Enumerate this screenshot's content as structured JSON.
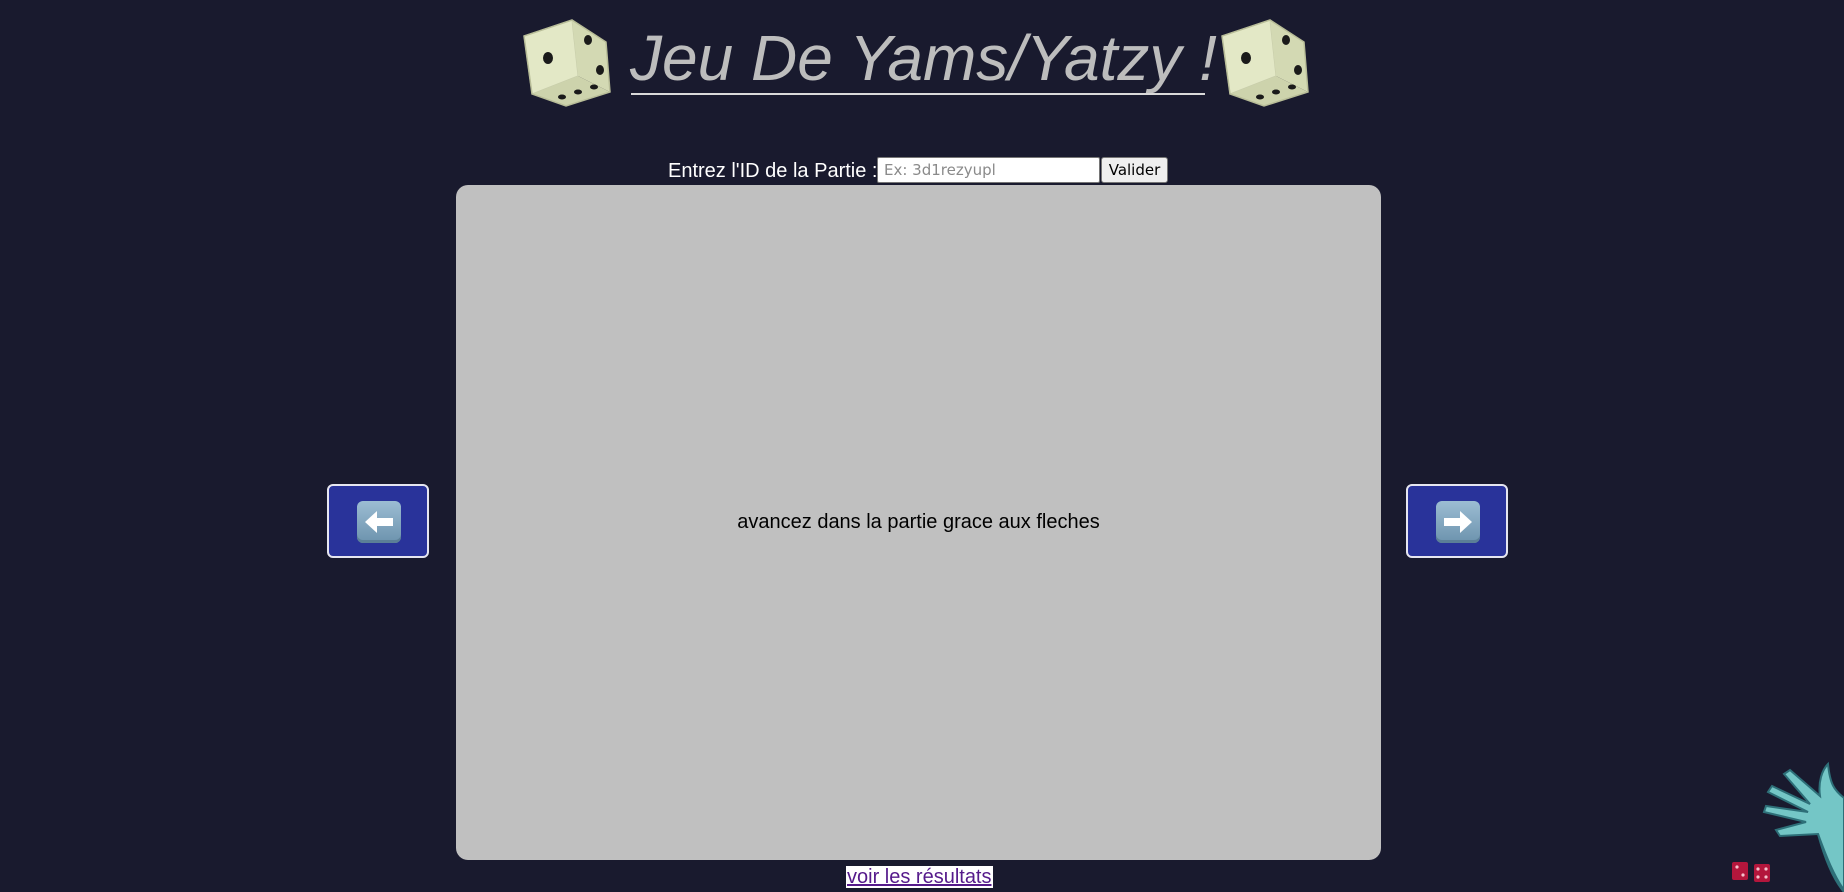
{
  "header": {
    "title": "Jeu De Yams/Yatzy !",
    "left_dice_icon": "dice-icon",
    "right_dice_icon": "dice-icon"
  },
  "game_id": {
    "label": "Entrez l'ID de la Partie :",
    "placeholder": "Ex: 3d1rezyupl",
    "value": "",
    "submit_label": "Valider"
  },
  "board": {
    "message": "avancez dans la partie grace aux fleches"
  },
  "navigation": {
    "prev_icon": "left-arrow-icon",
    "next_icon": "right-arrow-icon"
  },
  "footer": {
    "results_link": "voir les résultats",
    "decoration_icon": "hand-dice-icon"
  },
  "colors": {
    "background": "#191a2e",
    "board": "#c0c0c0",
    "nav_button": "#29339a",
    "title": "#bdbdbd",
    "link": "#551a8b"
  }
}
